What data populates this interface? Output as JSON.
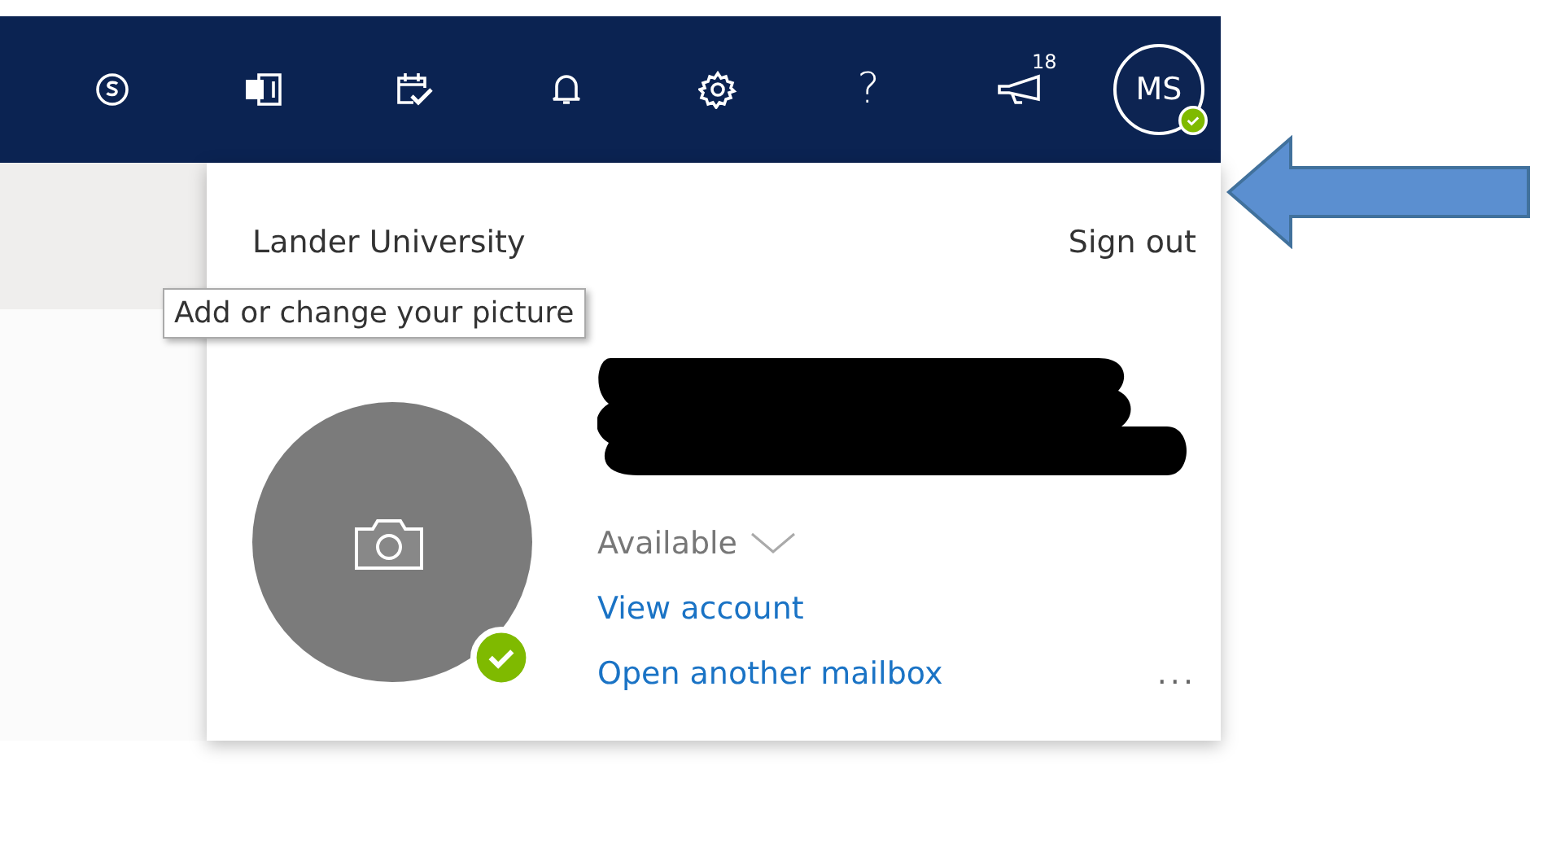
{
  "top_bar": {
    "icons": [
      {
        "kind": "skype"
      },
      {
        "kind": "onenote"
      },
      {
        "kind": "calendar-check"
      },
      {
        "kind": "bell"
      },
      {
        "kind": "gear"
      },
      {
        "kind": "help",
        "glyph": "?"
      },
      {
        "kind": "megaphone",
        "badge": "18"
      }
    ],
    "avatar": {
      "initials": "MS",
      "online": true
    }
  },
  "account_panel": {
    "organization": "Lander University",
    "sign_out": "Sign out",
    "tooltip": "Add or change your picture",
    "avatar": {
      "online": true
    },
    "name_redacted": true,
    "status": "Available",
    "links": [
      "View account",
      "Open another mailbox"
    ],
    "more": "..."
  },
  "annotation": {
    "kind": "arrow"
  }
}
